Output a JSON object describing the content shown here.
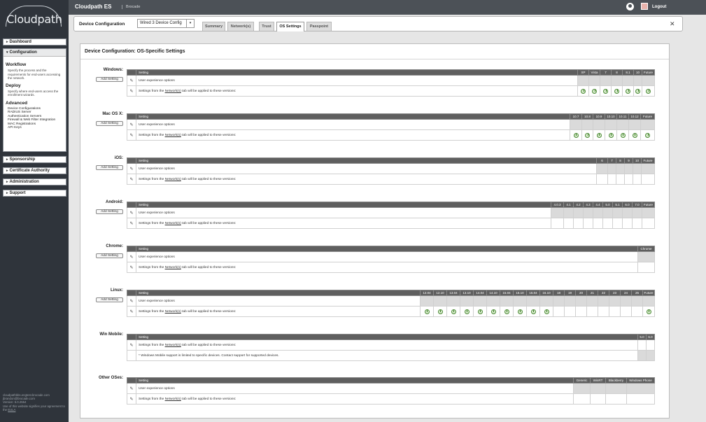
{
  "app": {
    "title": "Cloudpath ES",
    "brand": "Brocade",
    "logo": "Cloudpath",
    "logout": "Logout"
  },
  "nav": {
    "dashboard": "Dashboard",
    "configuration": "Configuration",
    "sponsorship": "Sponsorship",
    "certificate_authority": "Certificate Authority",
    "administration": "Administration",
    "support": "Support"
  },
  "config_panel": {
    "workflow": "Workflow",
    "workflow_desc": "Specify the process and the requirements for end-users accessing the network.",
    "deploy": "Deploy",
    "deploy_desc": "Specify where end-users access the enrollment wizards.",
    "advanced": "Advanced",
    "links": [
      "Device Configurations",
      "RADIUS Server",
      "Authentication Servers",
      "Firewall & Web Filter Integration",
      "MAC Registrations",
      "API Keys"
    ]
  },
  "footer": {
    "host": "cloudpathbbs.engtest.brocade.com",
    "email": "jbrandon@brocade.com",
    "version": "Version: 5.0.2554",
    "eula_prefix": "Use of this website signifies your agreement to the",
    "eula_link": "EULA"
  },
  "configbar": {
    "title": "Device Configuration",
    "select_value": "Wired 3 Device Config",
    "tabs": [
      "Summary",
      "Network(s)",
      "Trust",
      "OS Settings",
      "Passpoint"
    ],
    "active_tab": "OS Settings"
  },
  "main": {
    "header": "Device Configuration: OS-Specific Settings"
  },
  "labels": {
    "add_setting": "Add Setting",
    "setting_col": "Setting",
    "ux_options": "User experience options",
    "network_prefix": "Settings from the ",
    "network_link": "Network(s)",
    "network_suffix": " tab will be applied to these versions:",
    "winmobile_note": "* Windows Mobile support is limited to specific devices. Contact support for supported devices."
  },
  "os_sections": [
    {
      "name": "Windows:",
      "versions": [
        "XP",
        "Vista",
        "7",
        "8",
        "8.1",
        "10",
        "Future"
      ],
      "enabled": [
        true,
        true,
        true,
        true,
        true,
        true,
        true
      ],
      "has_ux": true,
      "has_add": true
    },
    {
      "name": "Mac OS X:",
      "versions": [
        "10.7",
        "10.8",
        "10.9",
        "10.10",
        "10.11",
        "10.12",
        "Future"
      ],
      "enabled": [
        true,
        true,
        true,
        true,
        true,
        true,
        true
      ],
      "has_ux": true,
      "has_add": true
    },
    {
      "name": "iOS:",
      "versions": [
        "6",
        "7",
        "8",
        "9",
        "10",
        "Future"
      ],
      "enabled": [
        false,
        false,
        false,
        false,
        false,
        false
      ],
      "has_ux": true,
      "has_add": true
    },
    {
      "name": "Android:",
      "versions": [
        "4.0.3",
        "4.1",
        "4.2",
        "4.3",
        "4.4",
        "5.0",
        "5.1",
        "6.0",
        "7.0",
        "Future"
      ],
      "enabled": [
        false,
        false,
        false,
        false,
        false,
        false,
        false,
        false,
        false,
        false
      ],
      "has_ux": true,
      "has_add": true
    },
    {
      "name": "Chrome:",
      "versions": [
        "Chrome"
      ],
      "enabled": [
        false
      ],
      "has_ux": true,
      "has_add": true
    },
    {
      "name": "Linux:",
      "versions": [
        "12.04",
        "12.10",
        "13.04",
        "13.10",
        "14.04",
        "14.10",
        "15.04",
        "15.10",
        "16.04",
        "16.10",
        "18",
        "19",
        "20",
        "21",
        "22",
        "23",
        "24",
        "25",
        "Future"
      ],
      "enabled": [
        true,
        true,
        true,
        true,
        true,
        true,
        true,
        true,
        true,
        true,
        false,
        false,
        false,
        false,
        false,
        false,
        false,
        false,
        true
      ],
      "has_ux": true,
      "has_add": true
    },
    {
      "name": "Win Mobile:",
      "versions": [
        "5.0",
        "6.0"
      ],
      "enabled": [
        false,
        false
      ],
      "has_ux": false,
      "has_add": false,
      "note": true
    },
    {
      "name": "Other OSes:",
      "versions": [
        "Generic",
        "WinRT",
        "Blackberry",
        "Windows Phone"
      ],
      "enabled": [
        false,
        false,
        false,
        false
      ],
      "has_ux": true,
      "has_add": false
    }
  ]
}
